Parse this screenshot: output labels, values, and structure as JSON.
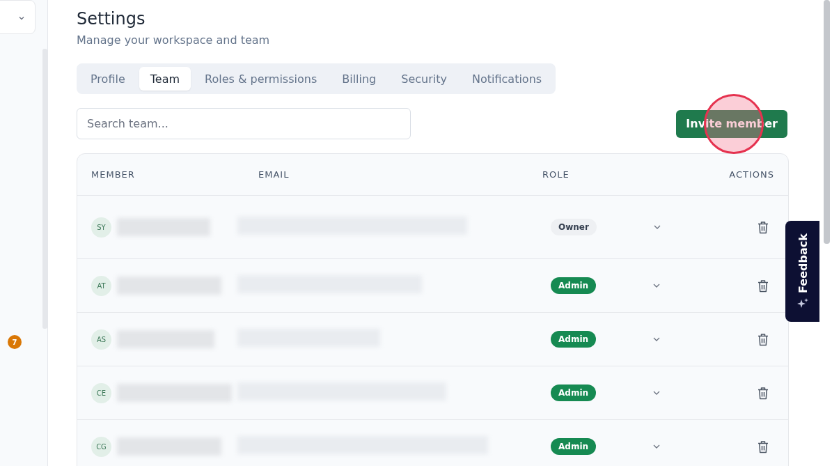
{
  "sidebar": {
    "badge": "7"
  },
  "header": {
    "title": "Settings",
    "subtitle": "Manage your workspace and team"
  },
  "tabs": [
    {
      "label": "Profile",
      "selected": false
    },
    {
      "label": "Team",
      "selected": true
    },
    {
      "label": "Roles & permissions",
      "selected": false
    },
    {
      "label": "Billing",
      "selected": false
    },
    {
      "label": "Security",
      "selected": false
    },
    {
      "label": "Notifications",
      "selected": false
    }
  ],
  "search": {
    "placeholder": "Search team..."
  },
  "invite_button": "Invite member",
  "table": {
    "columns": [
      "MEMBER",
      "EMAIL",
      "ROLE",
      "ACTIONS"
    ],
    "rows": [
      {
        "initials": "SY",
        "role": "Owner",
        "kind": "owner"
      },
      {
        "initials": "AT",
        "role": "Admin",
        "kind": "admin"
      },
      {
        "initials": "AS",
        "role": "Admin",
        "kind": "admin"
      },
      {
        "initials": "CE",
        "role": "Admin",
        "kind": "admin"
      },
      {
        "initials": "CG",
        "role": "Admin",
        "kind": "admin"
      }
    ]
  },
  "feedback": {
    "label": "Feedback"
  }
}
